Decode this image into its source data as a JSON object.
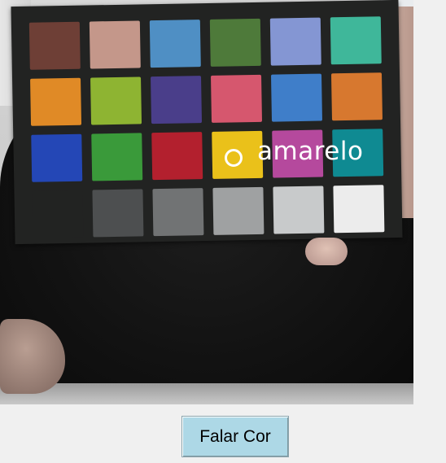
{
  "camera_view": {
    "detected_color_label": "amarelo",
    "marker_icon": "circle-marker-icon",
    "color_checker": {
      "patch_colors": [
        [
          "#6e3f36",
          "#c4978a",
          "#4f8fc4",
          "#4e7a3a",
          "#8496d3",
          "#3fb79a"
        ],
        [
          "#e08a26",
          "#8eb432",
          "#4a3e8a",
          "#d6576e",
          "#3f7ec9",
          "#d7782f"
        ],
        [
          "#2447b6",
          "#3a9a3a",
          "#b3202e",
          "#eac11a",
          "#b5499d",
          "#0f8a92"
        ],
        [
          "#222322",
          "#4d4f50",
          "#717374",
          "#9fa1a2",
          "#c8cacb",
          "#ececec"
        ]
      ]
    }
  },
  "controls": {
    "speak_button_label": "Falar Cor"
  },
  "colors": {
    "button_background": "#add8e6",
    "window_background": "#f0f0f0",
    "marker": "#ffffff"
  }
}
